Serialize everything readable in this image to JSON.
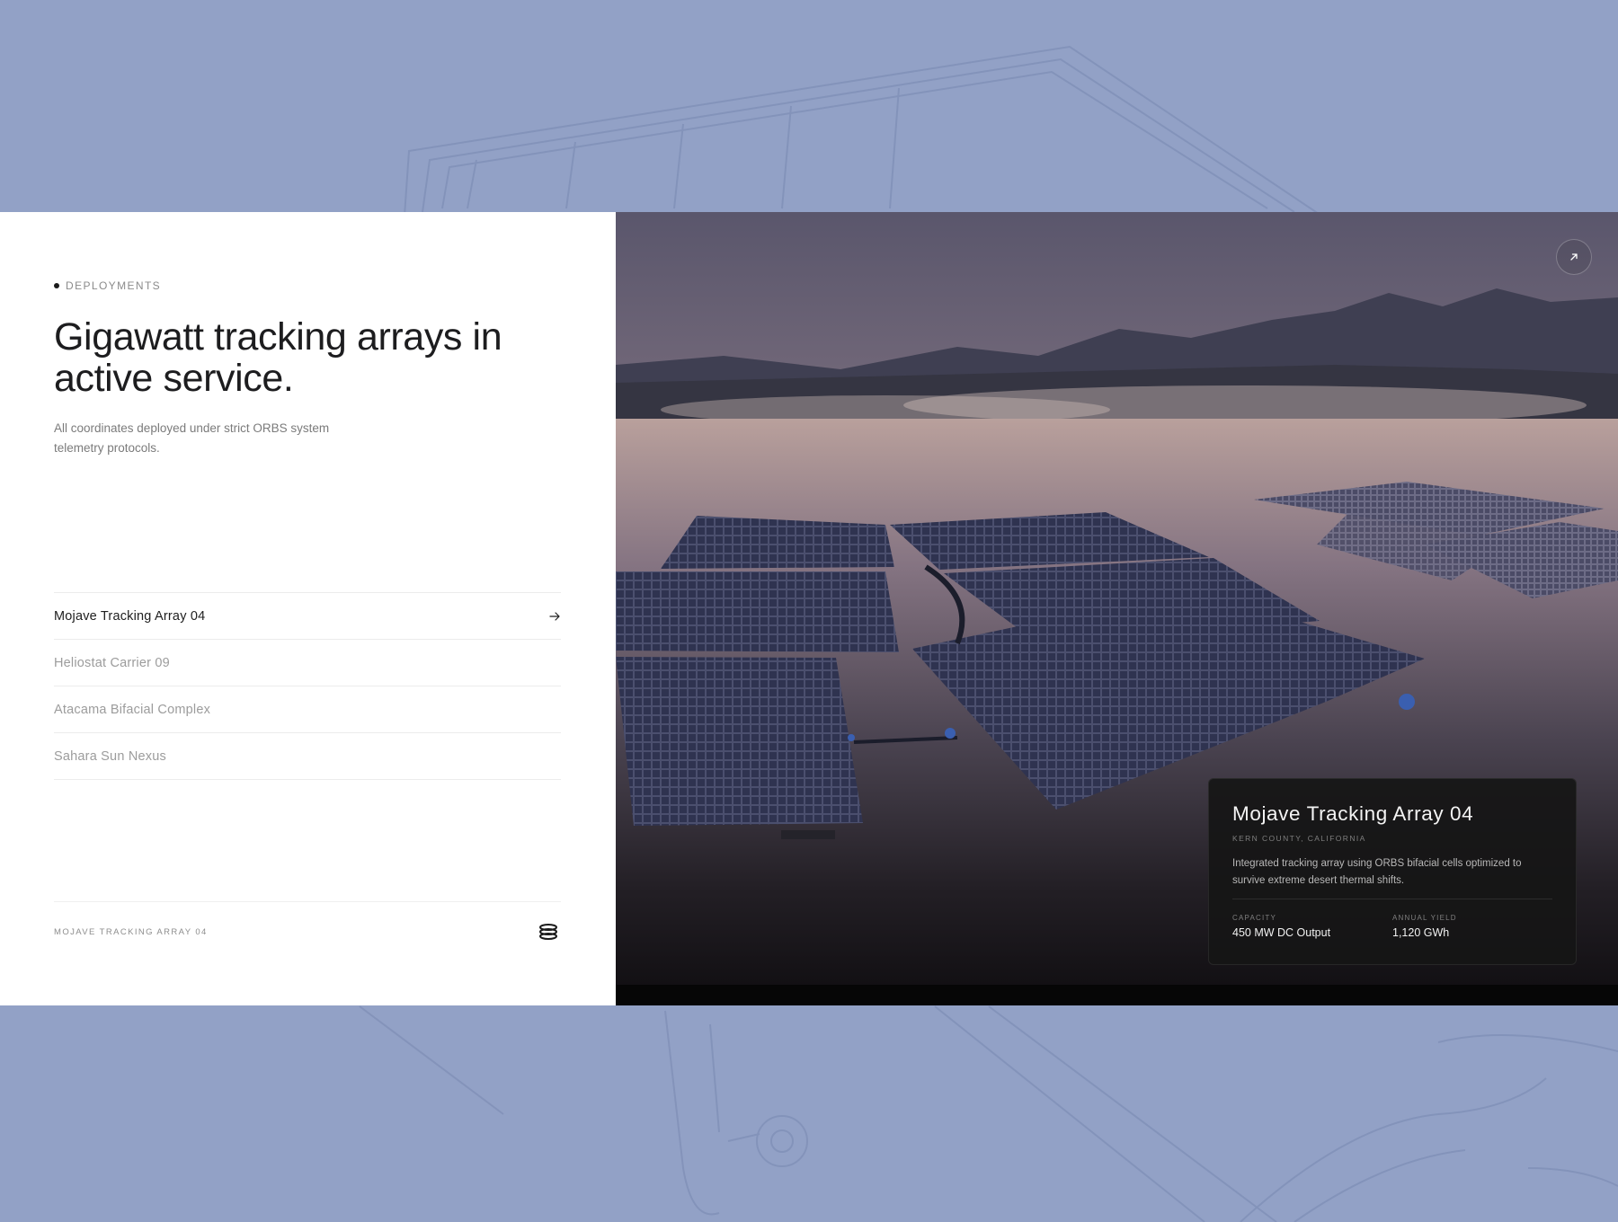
{
  "section": {
    "eyebrow": "DEPLOYMENTS",
    "headline": "Gigawatt tracking arrays in active service.",
    "subcopy": "All coordinates deployed under strict ORBS system telemetry protocols."
  },
  "deployments": {
    "items": [
      {
        "label": "Mojave Tracking Array 04"
      },
      {
        "label": "Heliostat Carrier 09"
      },
      {
        "label": "Atacama Bifacial Complex"
      },
      {
        "label": "Sahara Sun Nexus"
      }
    ]
  },
  "footer": {
    "caption": "MOJAVE TRACKING ARRAY 04"
  },
  "card": {
    "title": "Mojave Tracking Array 04",
    "location": "KERN COUNTY, CALIFORNIA",
    "description": "Integrated tracking array using ORBS bifacial cells optimized to survive extreme desert thermal shifts.",
    "stats": [
      {
        "label": "CAPACITY",
        "value": "450 MW DC Output"
      },
      {
        "label": "ANNUAL YIELD",
        "value": "1,120 GWh"
      }
    ]
  },
  "icons": {
    "list_arrow": "arrow-right-icon",
    "expand": "arrow-up-right-icon",
    "logo": "orbs-logo-icon"
  },
  "colors": {
    "backdrop": "#92a1c6",
    "panel": "#ffffff",
    "card": "#161616"
  }
}
